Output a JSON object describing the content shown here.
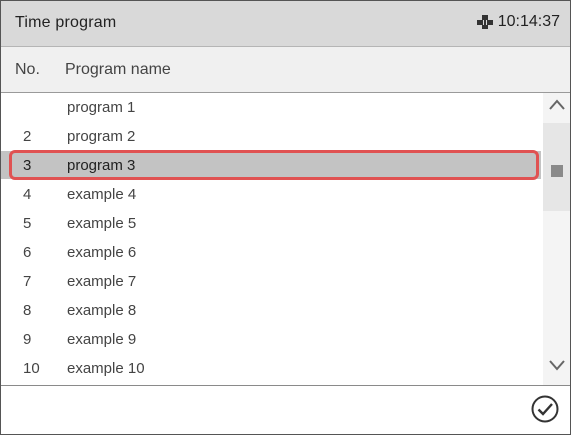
{
  "titlebar": {
    "title": "Time program",
    "time": "10:14:37",
    "status_icon": "network-icon"
  },
  "table": {
    "headers": {
      "no": "No.",
      "name": "Program name"
    },
    "rows": [
      {
        "no": "",
        "name": "program 1"
      },
      {
        "no": "2",
        "name": "program 2"
      },
      {
        "no": "3",
        "name": "program 3"
      },
      {
        "no": "4",
        "name": "example 4"
      },
      {
        "no": "5",
        "name": "example 5"
      },
      {
        "no": "6",
        "name": "example 6"
      },
      {
        "no": "7",
        "name": "example 7"
      },
      {
        "no": "8",
        "name": "example 8"
      },
      {
        "no": "9",
        "name": "example 9"
      },
      {
        "no": "10",
        "name": "example 10"
      }
    ],
    "selected_index": 2
  },
  "scrollbar": {
    "up_icon": "chevron-up-icon",
    "down_icon": "chevron-down-icon"
  },
  "footer": {
    "confirm_icon": "checkmark-circle-icon"
  },
  "colors": {
    "selection_outline": "#e05252",
    "selected_row_bg": "#c3c3c3",
    "titlebar_bg": "#d9d9d9"
  }
}
